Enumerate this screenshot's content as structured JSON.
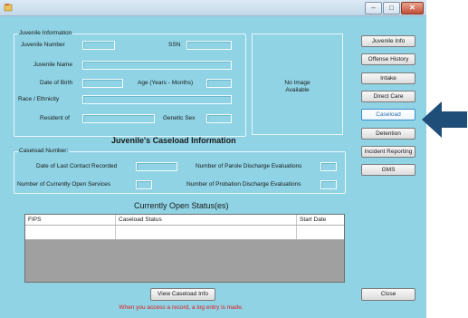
{
  "juvenile_info": {
    "legend": "Juvenile Information",
    "juvenile_number": "Juvenile Number",
    "ssn": "SSN",
    "juvenile_name": "Juvenile Name",
    "date_of_birth": "Date of Birth",
    "age": "Age (Years - Months)",
    "race": "Race / Ethnicity",
    "resident_of": "Resident of",
    "genetic_sex": "Genetic Sex"
  },
  "photo": {
    "text_line1": "No Image",
    "text_line2": "Available"
  },
  "caseload": {
    "heading": "Juvenile's Caseload Information",
    "legend": "Caseload Number:",
    "last_contact": "Date of Last Contact Recorded",
    "parole_discharge": "Number of Parole Discharge Evaluations",
    "open_services": "Number of Currently Open Services",
    "probation_discharge": "Number of Probation Discharge Evaluations"
  },
  "status": {
    "heading": "Currently Open Status(es)",
    "columns": [
      "FIPS",
      "Caseload Status",
      "Start Date"
    ]
  },
  "nav_buttons": [
    "Juvenile Info",
    "Offense History",
    "Intake",
    "Direct Care",
    "Caseload",
    "Detention",
    "Incident Reporting",
    "GMS"
  ],
  "footer": {
    "view_button": "View Caseload Info",
    "close_button": "Close",
    "log_note": "When you access a record, a log entry is made."
  },
  "colors": {
    "window_bg": "#8fd3e4",
    "arrow": "#1f4e79",
    "note": "#e01c1c",
    "active_button_text": "#2d6fb3"
  }
}
